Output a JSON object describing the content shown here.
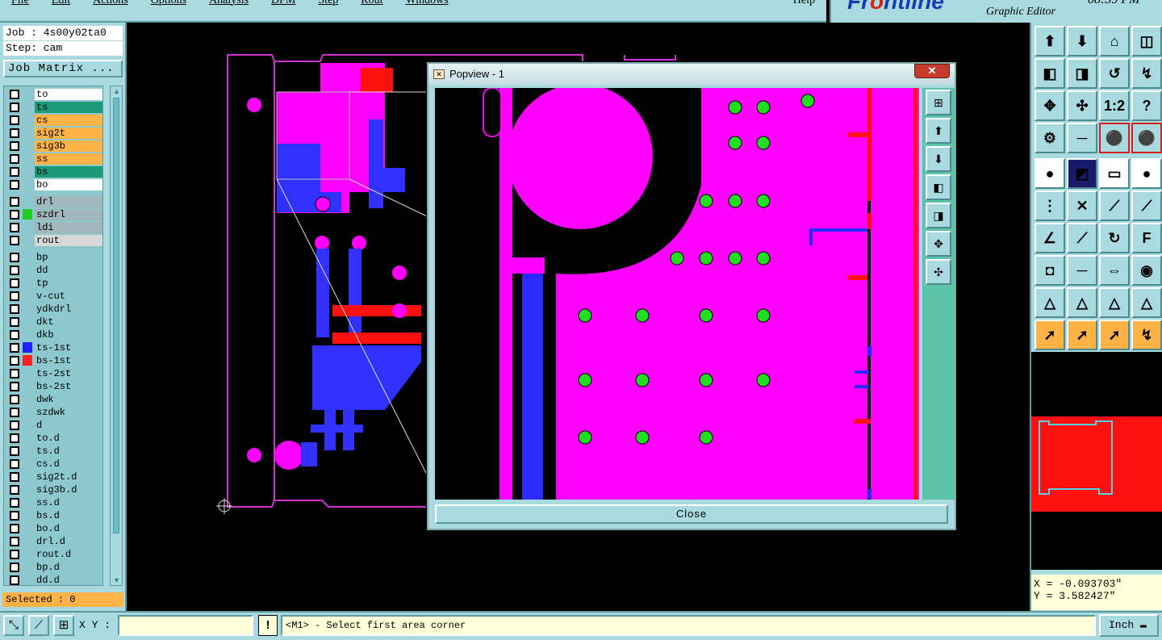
{
  "menubar": {
    "items": [
      "File",
      "Edit",
      "Actions",
      "Options",
      "Analysis",
      "DFM",
      "Step",
      "Rout",
      "Windows"
    ],
    "help": "Help"
  },
  "brand": {
    "logo_pre": "Fr",
    "logo_o": "o",
    "logo_post": "ntline",
    "subtitle": "Graphic Editor",
    "time": "08:39 PM"
  },
  "job": {
    "line": "Job : 4s00y02ta0",
    "step": "Step: cam",
    "matrix_button": "Job Matrix ..."
  },
  "layers": [
    {
      "name": "to",
      "swatch": "",
      "bg": "#ffffff"
    },
    {
      "name": "ts",
      "swatch": "",
      "bg": "#1a9a78"
    },
    {
      "name": "cs",
      "swatch": "",
      "bg": "#ffb347"
    },
    {
      "name": "sig2t",
      "swatch": "",
      "bg": "#ffb347"
    },
    {
      "name": "sig3b",
      "swatch": "",
      "bg": "#ffb347"
    },
    {
      "name": "ss",
      "swatch": "",
      "bg": "#ffb347"
    },
    {
      "name": "bs",
      "swatch": "",
      "bg": "#1a9a78"
    },
    {
      "name": "bo",
      "swatch": "",
      "bg": "#ffffff"
    },
    {
      "name": "drl",
      "swatch": "",
      "bg": "#a0b8bc"
    },
    {
      "name": "szdrl",
      "swatch": "#22cc22",
      "bg": "#a0b8bc"
    },
    {
      "name": "ldi",
      "swatch": "",
      "bg": "#a0b8bc"
    },
    {
      "name": "rout",
      "swatch": "",
      "bg": "#d8d8d8"
    },
    {
      "name": "bp",
      "swatch": "",
      "bg": "#8cc8ce"
    },
    {
      "name": "dd",
      "swatch": "",
      "bg": "#8cc8ce"
    },
    {
      "name": "tp",
      "swatch": "",
      "bg": "#8cc8ce"
    },
    {
      "name": "v-cut",
      "swatch": "",
      "bg": "#8cc8ce"
    },
    {
      "name": "ydkdrl",
      "swatch": "",
      "bg": "#8cc8ce"
    },
    {
      "name": "dkt",
      "swatch": "",
      "bg": "#8cc8ce"
    },
    {
      "name": "dkb",
      "swatch": "",
      "bg": "#8cc8ce"
    },
    {
      "name": "ts-1st",
      "swatch": "#2020ff",
      "bg": "#8cc8ce"
    },
    {
      "name": "bs-1st",
      "swatch": "#ff2020",
      "bg": "#8cc8ce"
    },
    {
      "name": "ts-2st",
      "swatch": "",
      "bg": "#8cc8ce"
    },
    {
      "name": "bs-2st",
      "swatch": "",
      "bg": "#8cc8ce"
    },
    {
      "name": "dwk",
      "swatch": "",
      "bg": "#8cc8ce"
    },
    {
      "name": "szdwk",
      "swatch": "",
      "bg": "#8cc8ce"
    },
    {
      "name": "d",
      "swatch": "",
      "bg": "#8cc8ce"
    },
    {
      "name": "to.d",
      "swatch": "",
      "bg": "#8cc8ce"
    },
    {
      "name": "ts.d",
      "swatch": "",
      "bg": "#8cc8ce"
    },
    {
      "name": "cs.d",
      "swatch": "",
      "bg": "#8cc8ce"
    },
    {
      "name": "sig2t.d",
      "swatch": "",
      "bg": "#8cc8ce"
    },
    {
      "name": "sig3b.d",
      "swatch": "",
      "bg": "#8cc8ce"
    },
    {
      "name": "ss.d",
      "swatch": "",
      "bg": "#8cc8ce"
    },
    {
      "name": "bs.d",
      "swatch": "",
      "bg": "#8cc8ce"
    },
    {
      "name": "bo.d",
      "swatch": "",
      "bg": "#8cc8ce"
    },
    {
      "name": "drl.d",
      "swatch": "",
      "bg": "#8cc8ce"
    },
    {
      "name": "rout.d",
      "swatch": "",
      "bg": "#8cc8ce"
    },
    {
      "name": "bp.d",
      "swatch": "",
      "bg": "#8cc8ce"
    },
    {
      "name": "dd.d",
      "swatch": "",
      "bg": "#8cc8ce"
    }
  ],
  "selected": "Selected : 0",
  "status": {
    "xy_label": "X Y :",
    "xy_value": "",
    "excl": "!",
    "message": "<M1> - Select first area corner",
    "units": "Inch"
  },
  "coords": {
    "x": "X = -0.093703\"",
    "y": "Y = 3.582427\""
  },
  "popview": {
    "title": "Popview - 1",
    "close_x": "✕",
    "close_button": "Close"
  },
  "toolbar_icons": [
    "layer-up-icon",
    "layer-down-icon",
    "home-icon",
    "window-icon",
    "pan-left-icon",
    "pan-right-icon",
    "zoom-back-icon",
    "snake-icon",
    "zoom-fit-icon",
    "zoom-center-icon",
    "ratio-1-2-icon",
    "help-icon",
    "measure-icon",
    "probe-icon",
    "snap-red-icon",
    "snap-blue-icon",
    "add-pad-icon",
    "draw-line-icon",
    "ruler-icon",
    "fill-icon",
    "connect-icon",
    "delete-point-icon",
    "arc-point-icon",
    "line-point-icon",
    "angle-icon",
    "slash-icon",
    "rotate-icon",
    "font-icon",
    "pad-select-icon",
    "cut-line-icon",
    "dimension-icon",
    "shape-icon",
    "triangle-icon",
    "triangle-up-icon",
    "triangle-mark-icon",
    "triangle-ruler-icon",
    "pointer-icon",
    "select-box-icon",
    "select-shape-icon",
    "route-icon"
  ],
  "ratio_label": "1:2",
  "help_glyph": "?"
}
